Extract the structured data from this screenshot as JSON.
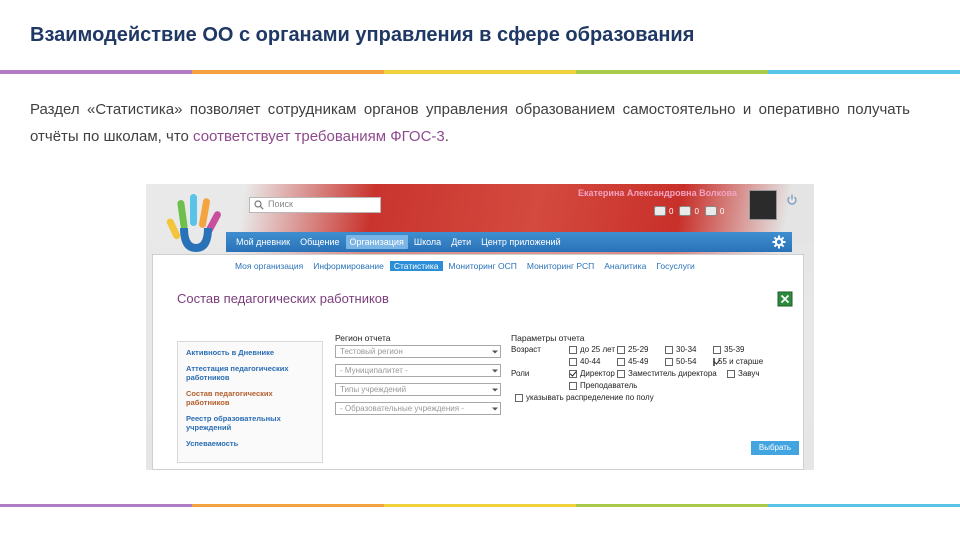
{
  "slide": {
    "title": "Взаимодействие ОО с органами управления в сфере образования",
    "intro_part1": "Раздел «Статистика» позволяет сотрудникам органов управления образованием самостоятельно и оперативно получать отчёты по школам, что ",
    "intro_highlight": "соответствует требованиям ФГОС-3",
    "intro_part3": ".",
    "stripe_colors": [
      "#b07cc6",
      "#f4a340",
      "#f2d23a",
      "#a8c94a",
      "#59c4e8"
    ]
  },
  "app": {
    "user_name": "Екатерина Александровна Волкова",
    "search_placeholder": "Поиск",
    "counters": [
      "0",
      "0",
      "0"
    ],
    "nav": [
      {
        "label": "Мой дневник"
      },
      {
        "label": "Общение"
      },
      {
        "label": "Организация",
        "active": true
      },
      {
        "label": "Школа"
      },
      {
        "label": "Дети"
      },
      {
        "label": "Центр приложений"
      }
    ],
    "subnav": [
      {
        "label": "Моя организация"
      },
      {
        "label": "Информирование"
      },
      {
        "label": "Статистика",
        "active": true
      },
      {
        "label": "Мониторинг ОСП"
      },
      {
        "label": "Мониторинг РСП"
      },
      {
        "label": "Аналитика"
      },
      {
        "label": "Госуслуги"
      }
    ],
    "page_title": "Состав педагогических работников",
    "sidebar": [
      {
        "label": "Активность в Дневнике"
      },
      {
        "label": "Аттестация педагогических работников"
      },
      {
        "label": "Состав педагогических работников",
        "active": true
      },
      {
        "label": "Реестр образовательных учреждений"
      },
      {
        "label": "Успеваемость"
      }
    ],
    "region": {
      "label": "Регион отчета",
      "selects": [
        "Тестовый регион",
        "- Муниципалитет -",
        "Типы учреждений",
        "- Образовательные учреждения -"
      ]
    },
    "params": {
      "label": "Параметры отчета",
      "age_label": "Возраст",
      "ages": [
        {
          "label": "до 25 лет",
          "checked": false
        },
        {
          "label": "25-29",
          "checked": false
        },
        {
          "label": "30-34",
          "checked": false
        },
        {
          "label": "35-39",
          "checked": false
        },
        {
          "label": "40-44",
          "checked": false
        },
        {
          "label": "45-49",
          "checked": false
        },
        {
          "label": "50-54",
          "checked": false
        },
        {
          "label": "55 и старше",
          "checked": true
        }
      ],
      "roles_label": "Роли",
      "roles": [
        {
          "label": "Директор",
          "checked": true
        },
        {
          "label": "Заместитель директора",
          "checked": false
        },
        {
          "label": "Завуч",
          "checked": false
        },
        {
          "label": "Преподаватель",
          "checked": false
        }
      ],
      "gender_distribution": "указывать распределение по полу"
    },
    "select_button": "Выбрать"
  }
}
